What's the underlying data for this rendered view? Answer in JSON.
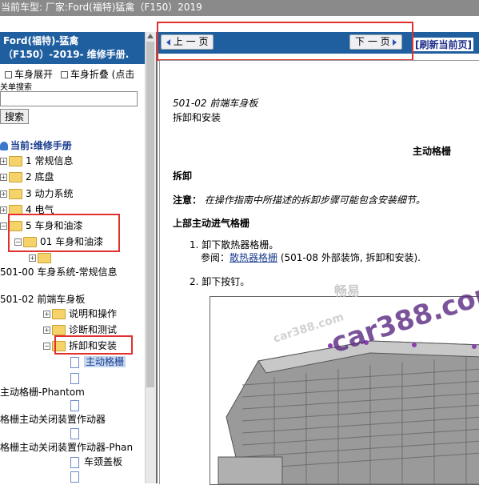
{
  "top_bar": {
    "text": "当前车型:   厂家:Ford(福特)猛禽（F150）2019"
  },
  "left_panel": {
    "title_line1": "Ford(福特)-猛禽",
    "title_line2": "（F150）-2019- 维修手册.",
    "expand_label": "车身展开",
    "collapse_label": "车身折叠 (点击",
    "search_label": "关单搜索",
    "search_value": "",
    "search_button": "搜索",
    "tree": {
      "current": "当前:维修手册",
      "items": [
        "1 常规信息",
        "2 底盘",
        "3 动力系统",
        "4 电气",
        "5 车身和油漆",
        "01 车身和油漆",
        "501-00 车身系统-常规信息",
        "501-02 前端车身板",
        "说明和操作",
        "诊断和测试",
        "拆卸和安装",
        "主动格栅",
        "主动格栅-Phantom",
        "格栅主动关闭装置作动器",
        "格栅主动关闭装置作动器-Phan",
        "车颈盖板"
      ]
    }
  },
  "nav": {
    "prev_label": "上 一 页",
    "next_label": "下 一 页",
    "refresh_label": "[刷新当前页]"
  },
  "document": {
    "section": "501-02 前端车身板",
    "subsection": "拆卸和安装",
    "title": "主动格栅",
    "removal_heading": "拆卸",
    "note_label": "注意：",
    "note_text": "在操作指南中所描述的拆卸步骤可能包含安装细节。",
    "part_heading": "上部主动进气格栅",
    "step1": "1. 卸下散热器格栅。",
    "step1_ref_prefix": "参阅：",
    "step1_ref_link": "散热器格栅",
    "step1_ref_suffix": "(501-08 外部装饰, 拆卸和安装).",
    "step2": "2. 卸下按钉。"
  },
  "watermarks": {
    "large": "car388.com",
    "small": "畅易",
    "small2": "car388.com"
  },
  "colors": {
    "header_blue": "#1f5fa0",
    "highlight_red": "#e03030",
    "watermark_purple": "#7b3fa0"
  }
}
